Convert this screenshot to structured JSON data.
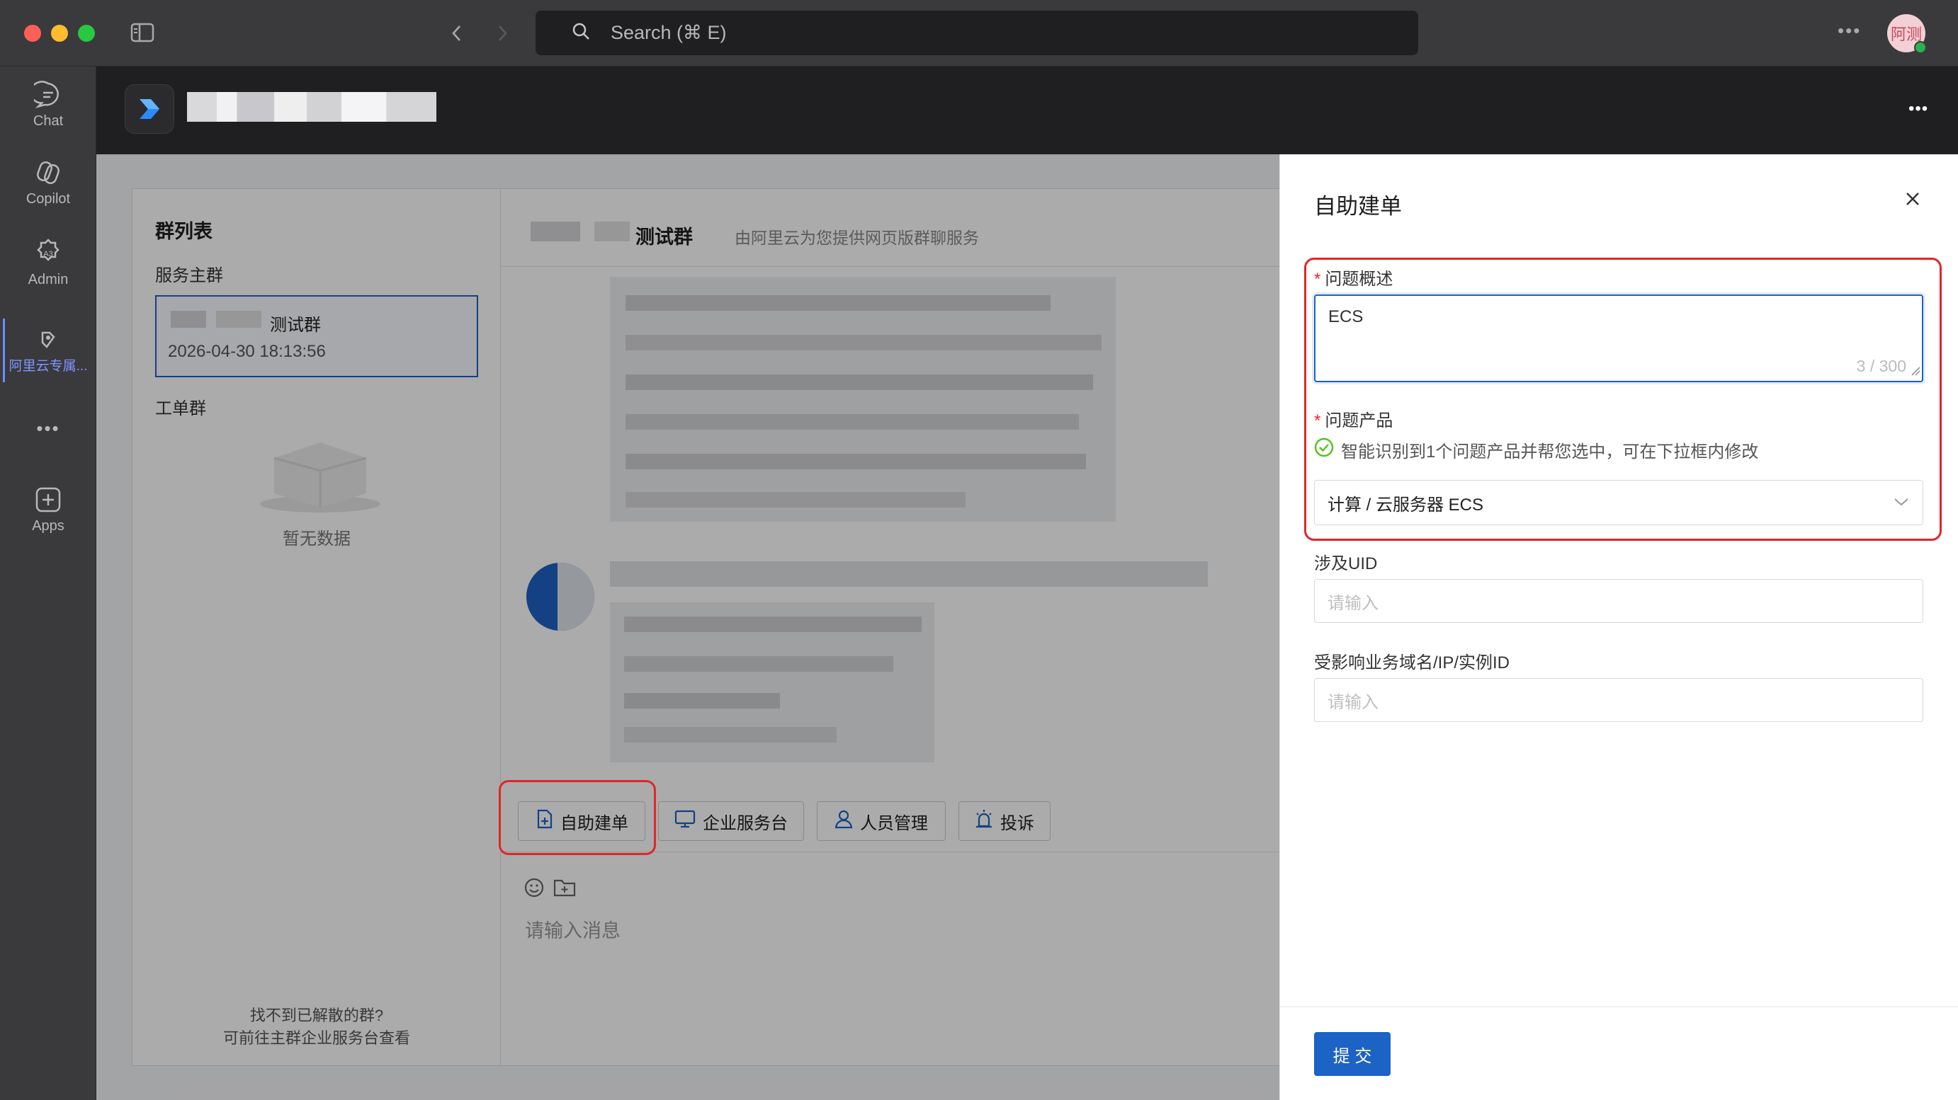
{
  "titlebar": {
    "search_placeholder": "Search (⌘ E)",
    "avatar_text": "阿测"
  },
  "rail": {
    "items": [
      {
        "label": "Chat",
        "icon": "chat-icon"
      },
      {
        "label": "Copilot",
        "icon": "copilot-icon"
      },
      {
        "label": "Admin",
        "icon": "admin-icon"
      },
      {
        "label": "阿里云专属...",
        "icon": "aliyun-icon"
      },
      {
        "label": "Apps",
        "icon": "apps-icon"
      }
    ],
    "more_label": "•••"
  },
  "group_list": {
    "title": "群列表",
    "service_section": "服务主群",
    "selected_group_name": "测试群",
    "selected_group_time": "2026-04-30 18:13:56",
    "ticket_section": "工单群",
    "empty_text": "暂无数据",
    "footer_line1": "找不到已解散的群?",
    "footer_line2": "可前往主群企业服务台查看"
  },
  "chat": {
    "group_title": "测试群",
    "group_subtitle": "由阿里云为您提供网页版群聊服务",
    "toolbar": [
      {
        "label": "自助建单",
        "icon": "ticket-add-icon"
      },
      {
        "label": "企业服务台",
        "icon": "monitor-icon"
      },
      {
        "label": "人员管理",
        "icon": "person-icon"
      },
      {
        "label": "投诉",
        "icon": "alarm-icon"
      }
    ],
    "input_placeholder": "请输入消息"
  },
  "drawer": {
    "title": "自助建单",
    "field_problem_label": "问题概述",
    "field_problem_value": "ECS",
    "field_problem_counter": "3 / 300",
    "field_product_label": "问题产品",
    "field_product_hint": "智能识别到1个问题产品并帮您选中，可在下拉框内修改",
    "field_product_value": "计算 / 云服务器 ECS",
    "field_uid_label": "涉及UID",
    "field_uid_placeholder": "请输入",
    "field_domain_label": "受影响业务域名/IP/实例ID",
    "field_domain_placeholder": "请输入",
    "submit_label": "提 交"
  },
  "colors": {
    "accent": "#1d62c5",
    "highlight": "#e0262a",
    "success": "#52c41a"
  }
}
